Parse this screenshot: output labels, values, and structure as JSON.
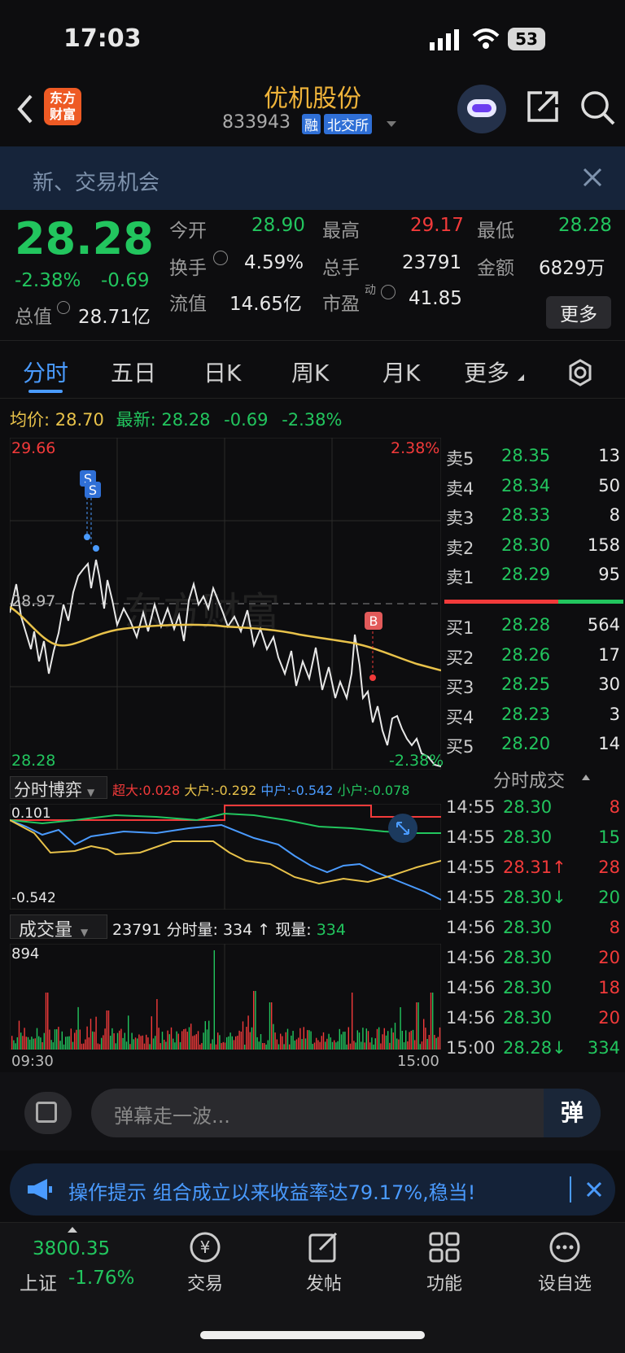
{
  "status": {
    "time": "17:03",
    "battery": "53"
  },
  "header": {
    "logo": "东方\n财富",
    "title": "优机股份",
    "code": "833943",
    "tag_rong": "融",
    "exchange": "北交所"
  },
  "banner": {
    "text": "新、交易机会"
  },
  "quote": {
    "price": "28.28",
    "pct": "-2.38%",
    "chg": "-0.69",
    "open_l": "今开",
    "open": "28.90",
    "high_l": "最高",
    "high": "29.17",
    "low_l": "最低",
    "low": "28.28",
    "turn_l": "换手",
    "turn": "4.59%",
    "vol_l": "总手",
    "vol": "23791",
    "amt_l": "金额",
    "amt": "6829万",
    "mcap_l": "总值",
    "mcap": "28.71亿",
    "float_l": "流值",
    "float": "14.65亿",
    "pe_l": "市盈",
    "pe_sup": "动",
    "pe": "41.85",
    "more": "更多"
  },
  "tabs": [
    "分时",
    "五日",
    "日K",
    "周K",
    "月K",
    "更多"
  ],
  "info": {
    "avg_l": "均价:",
    "avg": "28.70",
    "last_l": "最新:",
    "last": "28.28",
    "chg": "-0.69",
    "pct": "-2.38%"
  },
  "chart": {
    "ymax": "29.66",
    "ymin": "28.28",
    "pre": "28.97",
    "pmax": "2.38%",
    "pmin": "-2.38%",
    "t0": "09:30",
    "t1": "15:00"
  },
  "bobi": {
    "title": "分时博弈",
    "cd_l": "超大:",
    "cd": "0.028",
    "dh_l": "大户:",
    "dh": "-0.292",
    "zh_l": "中户:",
    "zh": "-0.542",
    "xh_l": "小户:",
    "xh": "-0.078",
    "top": "0.101",
    "bot": "-0.542"
  },
  "volume": {
    "title": "成交量",
    "total": "23791",
    "fs_l": "分时量:",
    "fs": "334 ↑",
    "xl_l": "现量:",
    "xl": "334",
    "max": "894"
  },
  "asks": [
    [
      "卖5",
      "28.35",
      "13"
    ],
    [
      "卖4",
      "28.34",
      "50"
    ],
    [
      "卖3",
      "28.33",
      "8"
    ],
    [
      "卖2",
      "28.30",
      "158"
    ],
    [
      "卖1",
      "28.29",
      "95"
    ]
  ],
  "bids": [
    [
      "买1",
      "28.28",
      "564"
    ],
    [
      "买2",
      "28.26",
      "17"
    ],
    [
      "买3",
      "28.25",
      "30"
    ],
    [
      "买4",
      "28.23",
      "3"
    ],
    [
      "买5",
      "28.20",
      "14"
    ]
  ],
  "ticks_title": "分时成交",
  "ticks": [
    [
      "14:55",
      "28.30",
      "8"
    ],
    [
      "14:55",
      "28.30",
      "15"
    ],
    [
      "14:55",
      "28.31↑",
      "28"
    ],
    [
      "14:55",
      "28.30↓",
      "20"
    ],
    [
      "14:56",
      "28.30",
      "8"
    ],
    [
      "14:56",
      "28.30",
      "20"
    ],
    [
      "14:56",
      "28.30",
      "18"
    ],
    [
      "14:56",
      "28.30",
      "20"
    ],
    [
      "15:00",
      "28.28↓",
      "334"
    ]
  ],
  "danmu": {
    "placeholder": "弹幕走一波...",
    "btn": "弹"
  },
  "notice": {
    "label": "操作提示",
    "text": "组合成立以来收益率达79.17%,稳当!"
  },
  "nav": {
    "index_val": "3800.35",
    "index_name": "上证",
    "index_pct": "-1.76%",
    "trade": "交易",
    "post": "发帖",
    "func": "功能",
    "watch": "设自选"
  }
}
